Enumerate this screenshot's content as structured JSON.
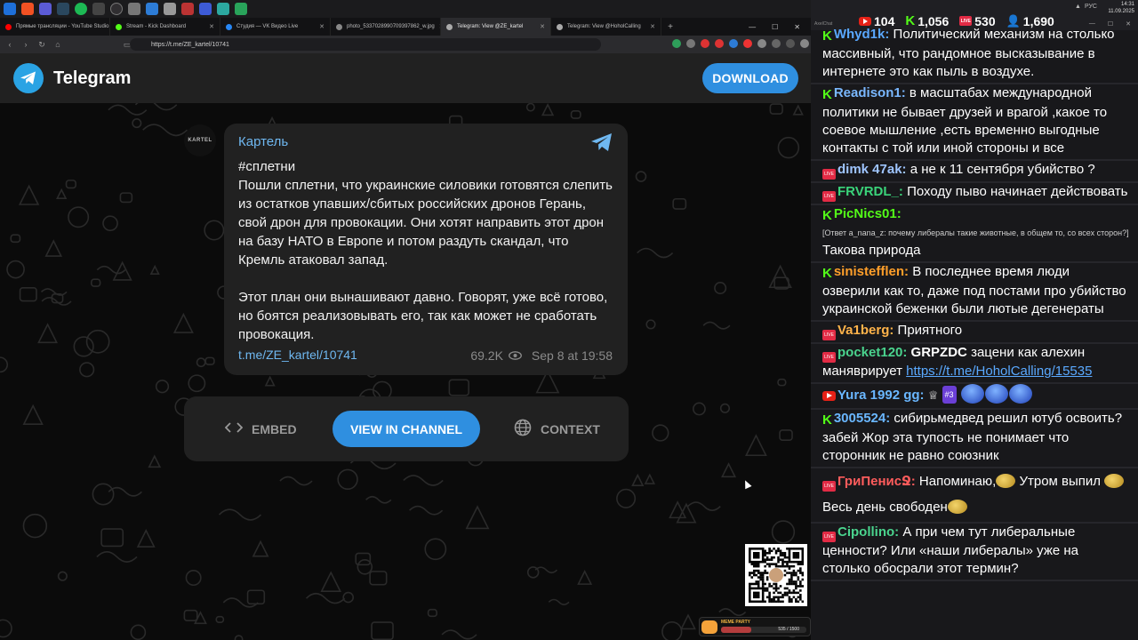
{
  "browser": {
    "tabs": [
      {
        "label": "Прямые трансляции - YouTube Studio",
        "color": "#ff0000",
        "active": false
      },
      {
        "label": "Stream - Kick Dashboard",
        "color": "#53fc18",
        "active": false
      },
      {
        "label": "Студия — VK Видео Live",
        "color": "#2787f5",
        "active": false
      },
      {
        "label": "photo_5337028990709397862_w.jpg",
        "color": "#888888",
        "active": false
      },
      {
        "label": "Telegram: View @ZE_kartel",
        "color": "#aaaaaa",
        "active": true
      },
      {
        "label": "Telegram: View @HoholCalling",
        "color": "#aaaaaa",
        "active": false
      }
    ],
    "url": "https://t.me/ZE_kartel/10741"
  },
  "telegram": {
    "brand": "Telegram",
    "download_label": "DOWNLOAD",
    "avatar_text": "KARTEL",
    "post": {
      "author": "Картель",
      "text": "#сплетни\nПошли сплетни, что украинские силовики готовятся слепить из остатков упавших/сбитых российских дронов Герань, свой дрон для провокации. Они хотят направить этот дрон на базу НАТО в Европе и потом раздуть скандал, что Кремль атаковал запад.\n\nЭтот план они вынашивают давно. Говорят, уже всё готово, но боятся реализовывать его, так как может не сработать провокация.",
      "link": "t.me/ZE_kartel/10741",
      "views": "69.2K",
      "date": "Sep 8 at 19:58"
    },
    "actions": {
      "embed": "EMBED",
      "view_in_channel": "VIEW IN CHANNEL",
      "context": "CONTEXT"
    }
  },
  "meme_party": {
    "title": "MEME PARTY",
    "count": "535 / 1500",
    "progress": 0.357
  },
  "chat": {
    "app_name": "AxelChat",
    "stats": {
      "youtube": "104",
      "kick": "1,056",
      "vk": "530",
      "viewers": "1,690"
    },
    "tray": {
      "time": "14:31",
      "date": "11.09.2025",
      "lang": "РУС"
    },
    "messages": [
      {
        "platform": "kick",
        "nick": "Whyd1k:",
        "color": "#5aa8ff",
        "text": "Политический механизм на столько массивный, что рандомное высказывание в интернете это как пыль в воздухе."
      },
      {
        "platform": "kick",
        "nick": "Readison1:",
        "color": "#7ab8ff",
        "text": "в масштабах международной политики не бывает друзей и врагой ,какое то соевое мышление ,есть временно выгодные контакты с той или иной стороны и все"
      },
      {
        "platform": "vk",
        "nick": "dimk 47ak:",
        "color": "#9fc5ff",
        "text": "а не к 11 сентября убийство ?"
      },
      {
        "platform": "vk",
        "nick": "FRVRDL_:",
        "color": "#3ad47a",
        "text": "Походу пыво начинает действовать"
      },
      {
        "platform": "kick",
        "nick": "PicNics01:",
        "color": "#53fc18",
        "reply": "[Ответ a_nana_z: почему либералы такие животные, в общем то, со всех сторон?]",
        "text": "Такова природа"
      },
      {
        "platform": "kick",
        "nick": "sinistefflen:",
        "color": "#ff9f2a",
        "text": "В последнее время люди озверили как то, даже под постами про убийство украинской беженки были лютые дегенераты"
      },
      {
        "platform": "vk",
        "nick": "Va1berg:",
        "color": "#ffb34a",
        "text": "Приятного"
      },
      {
        "platform": "vk",
        "nick": "pocket120:",
        "color": "#4ad48e",
        "bold": "GRPZDC",
        "text": "зацени как алехин маняврирует",
        "link": "https://t.me/HoholCalling/15535"
      },
      {
        "platform": "youtube",
        "nick": "Yura 1992 gg:",
        "color": "#6ab7ff",
        "level": "#3"
      },
      {
        "platform": "kick",
        "nick": "3005524:",
        "color": "#6ab7ff",
        "text": "сибирьмедвед решил ютуб освоить? забей Жор эта тупость не понимает что сторонник не равно союзник"
      },
      {
        "platform": "vk",
        "nick": "ГриПенисՋ:",
        "color": "#ff5c5c",
        "text": "Напоминаю,",
        "text2": "Утром выпил",
        "text3": "Весь день свободен"
      },
      {
        "platform": "vk",
        "nick": "Cipollino:",
        "color": "#4ad48e",
        "text": "А при чем тут либеральные ценности? Или «наши либералы» уже на столько обосрали этот термин?"
      }
    ]
  }
}
